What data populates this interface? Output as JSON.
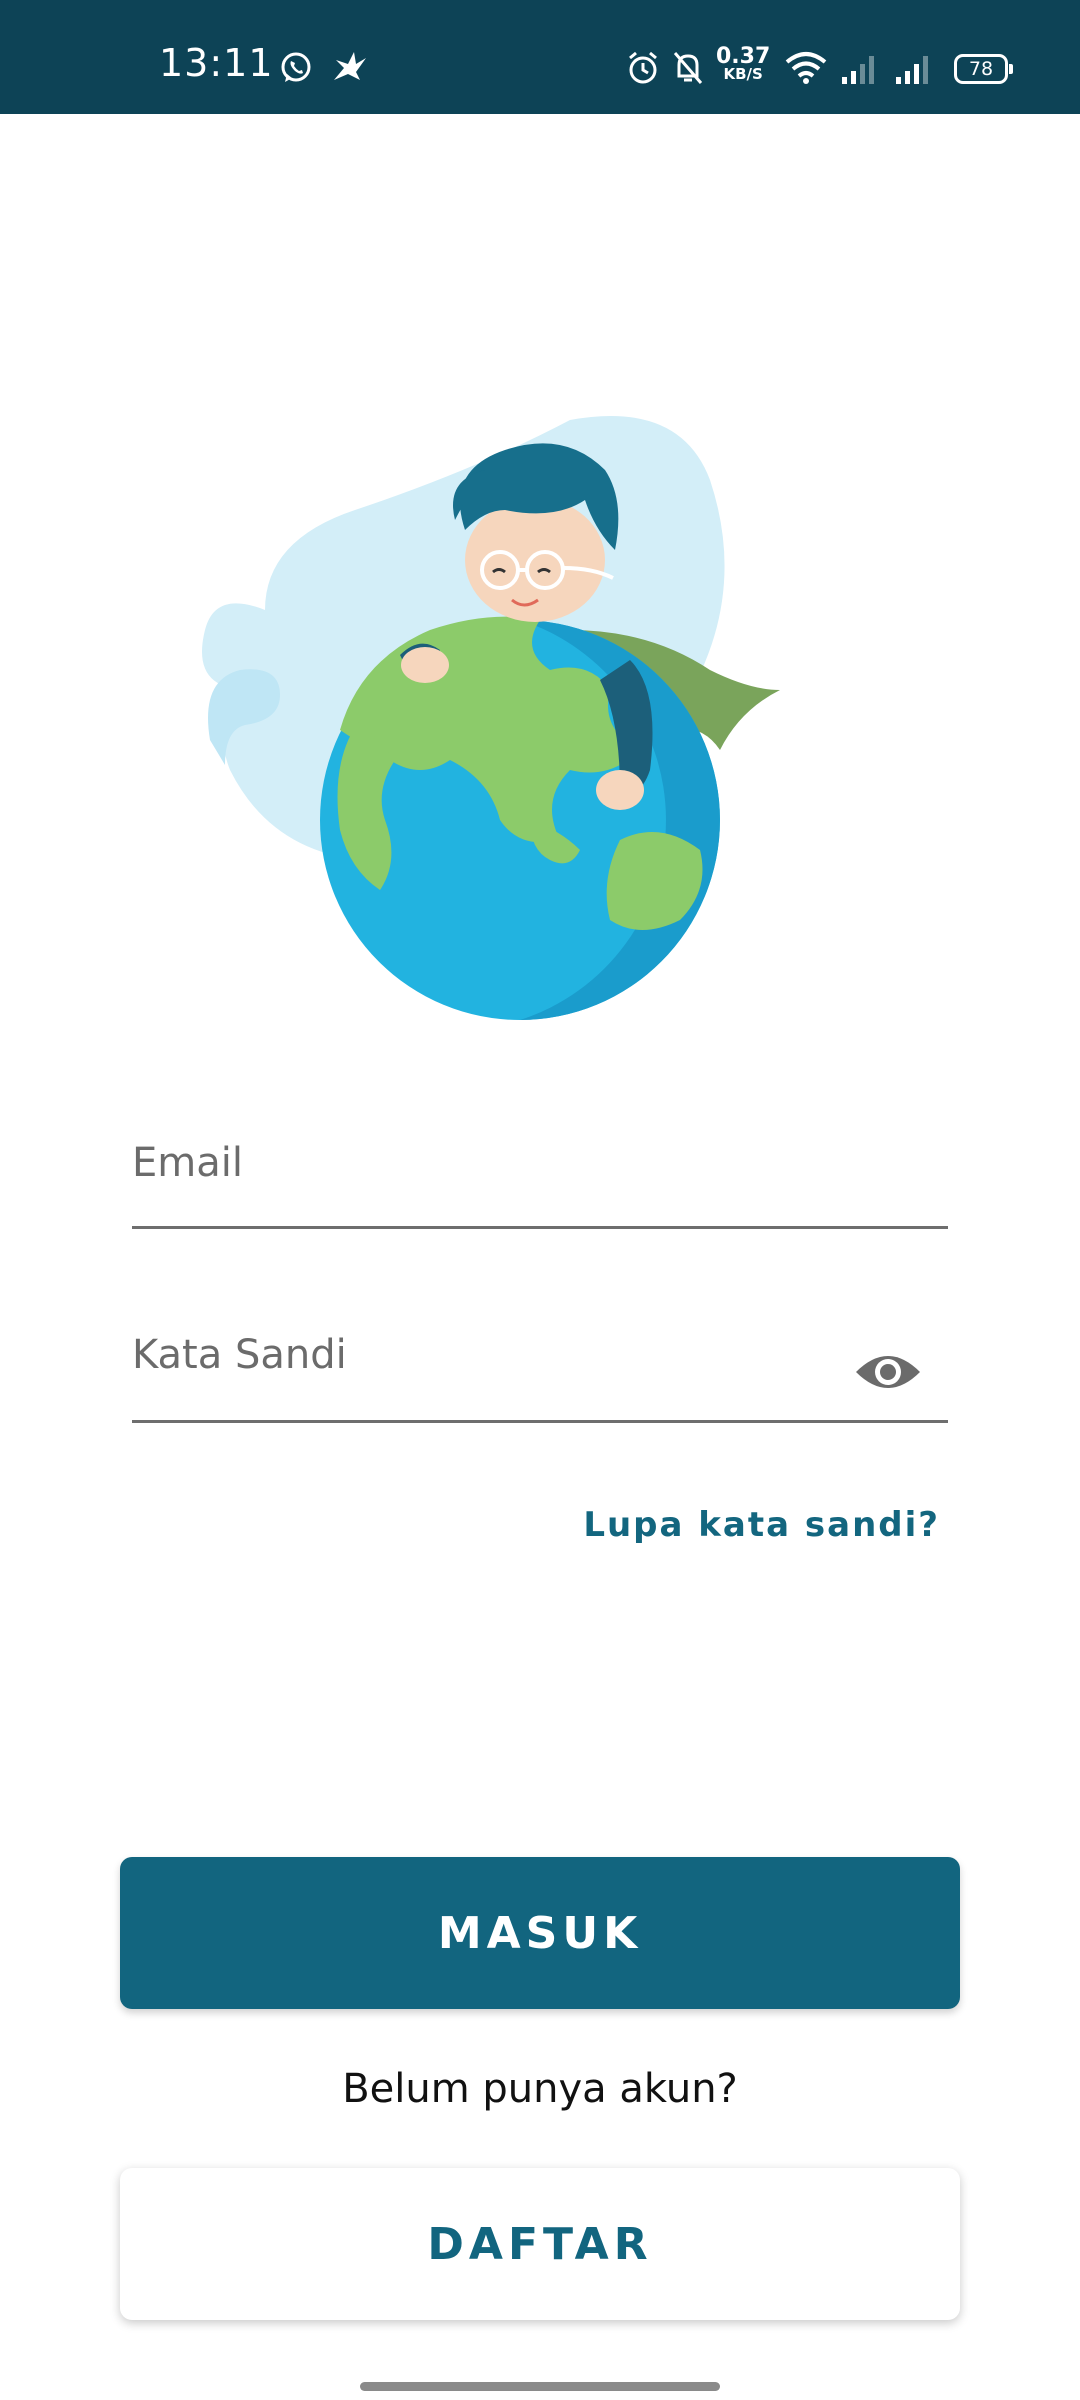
{
  "status_bar": {
    "time": "13:11",
    "network_speed_value": "0.37",
    "network_speed_unit": "KB/S",
    "battery_level": "78",
    "icons": [
      "whatsapp-icon",
      "app-bird-icon",
      "alarm-icon",
      "mute-icon",
      "wifi-icon",
      "signal-icon",
      "signal-icon",
      "battery-icon"
    ]
  },
  "login": {
    "email_placeholder": "Email",
    "password_placeholder": "Kata Sandi",
    "forgot_password": "Lupa kata sandi?",
    "login_button": "MASUK",
    "no_account_text": "Belum punya akun?",
    "register_button": "DAFTAR"
  },
  "colors": {
    "primary": "#12657f",
    "status_bar": "#0d4356",
    "background": "#ffffff"
  }
}
